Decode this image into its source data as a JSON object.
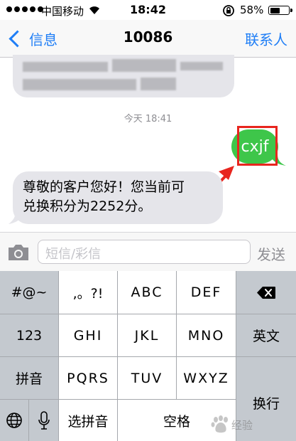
{
  "status_bar": {
    "carrier": "中国移动",
    "time": "18:42",
    "battery_percent": "58%",
    "battery_level": 0.58
  },
  "nav": {
    "back_label": "信息",
    "title": "10086",
    "contacts_label": "联系人"
  },
  "conversation": {
    "timestamp": "今天 18:41",
    "sent_message": "cxjf",
    "received_message_line1": "尊敬的客户您好！您当前可",
    "received_message_line2": "兑换积分为2252分。"
  },
  "input": {
    "placeholder": "短信/彩信",
    "send_label": "发送"
  },
  "keyboard": {
    "symbols": "#@~",
    "punct": ",。?!",
    "abc": "ABC",
    "def": "DEF",
    "num": "123",
    "ghi": "GHI",
    "jkl": "JKL",
    "mno": "MNO",
    "english": "英文",
    "pinyin": "拼音",
    "pqrs": "PQRS",
    "tuv": "TUV",
    "wxyz": "WXYZ",
    "return": "换行",
    "select_pinyin": "选拼音",
    "space": "空格"
  },
  "watermark": {
    "text": "经验"
  },
  "colors": {
    "accent": "#1f7ef6",
    "sent_bubble": "#3ec64a",
    "received_bubble": "#e5e5ea",
    "highlight": "#e8251e"
  }
}
